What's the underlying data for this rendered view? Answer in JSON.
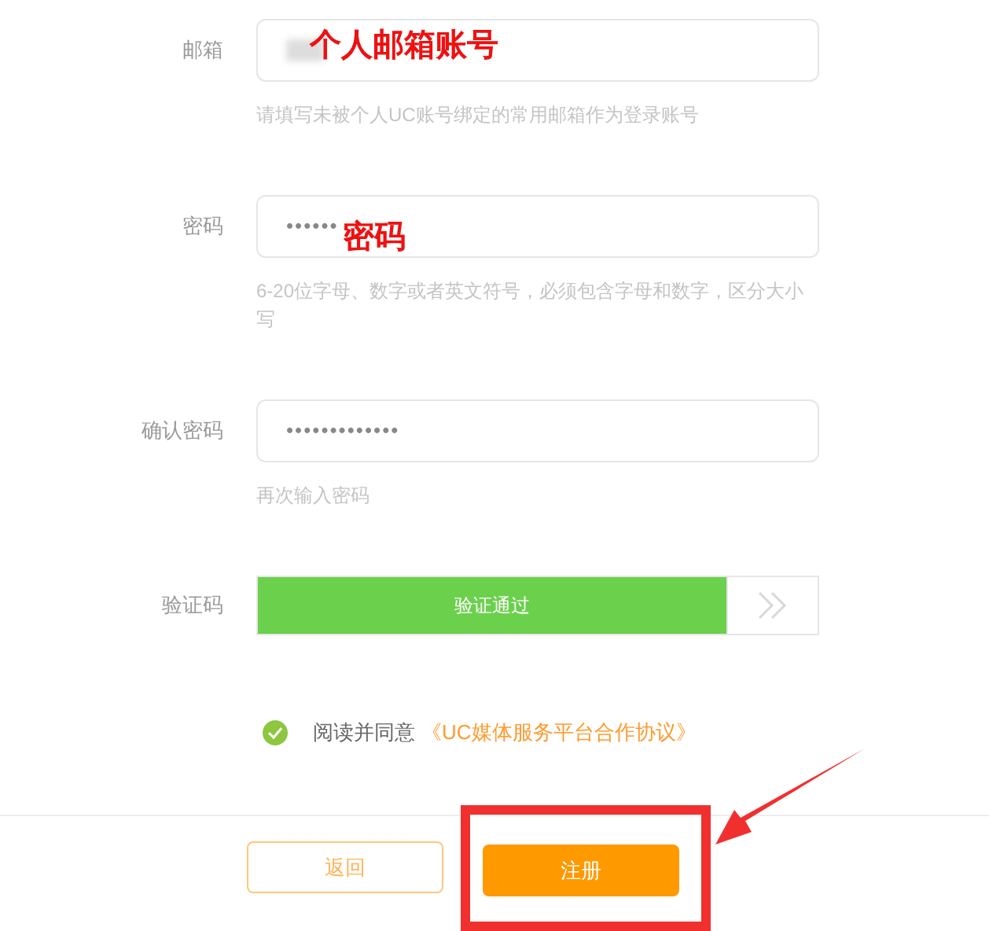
{
  "fields": [
    {
      "label": "邮箱",
      "kind": "email",
      "hint": "请填写未被个人UC账号绑定的常用邮箱作为登录账号",
      "annotation": "个人邮箱账号"
    },
    {
      "label": "密码",
      "kind": "password",
      "value": "••••••",
      "hint": "6-20位字母、数字或者英文符号，必须包含字母和数字，区分大小写",
      "annotation": "密码"
    },
    {
      "label": "确认密码",
      "kind": "password",
      "value": "•••••••••••••",
      "hint": "再次输入密码"
    }
  ],
  "captcha": {
    "label": "验证码",
    "status": "验证通过",
    "passed": true
  },
  "agreement": {
    "checked": true,
    "text": "阅读并同意",
    "link": "《UC媒体服务平台合作协议》"
  },
  "buttons": [
    {
      "label": "返回",
      "kind": "secondary"
    },
    {
      "label": "注册",
      "kind": "primary",
      "highlighted": true
    }
  ]
}
